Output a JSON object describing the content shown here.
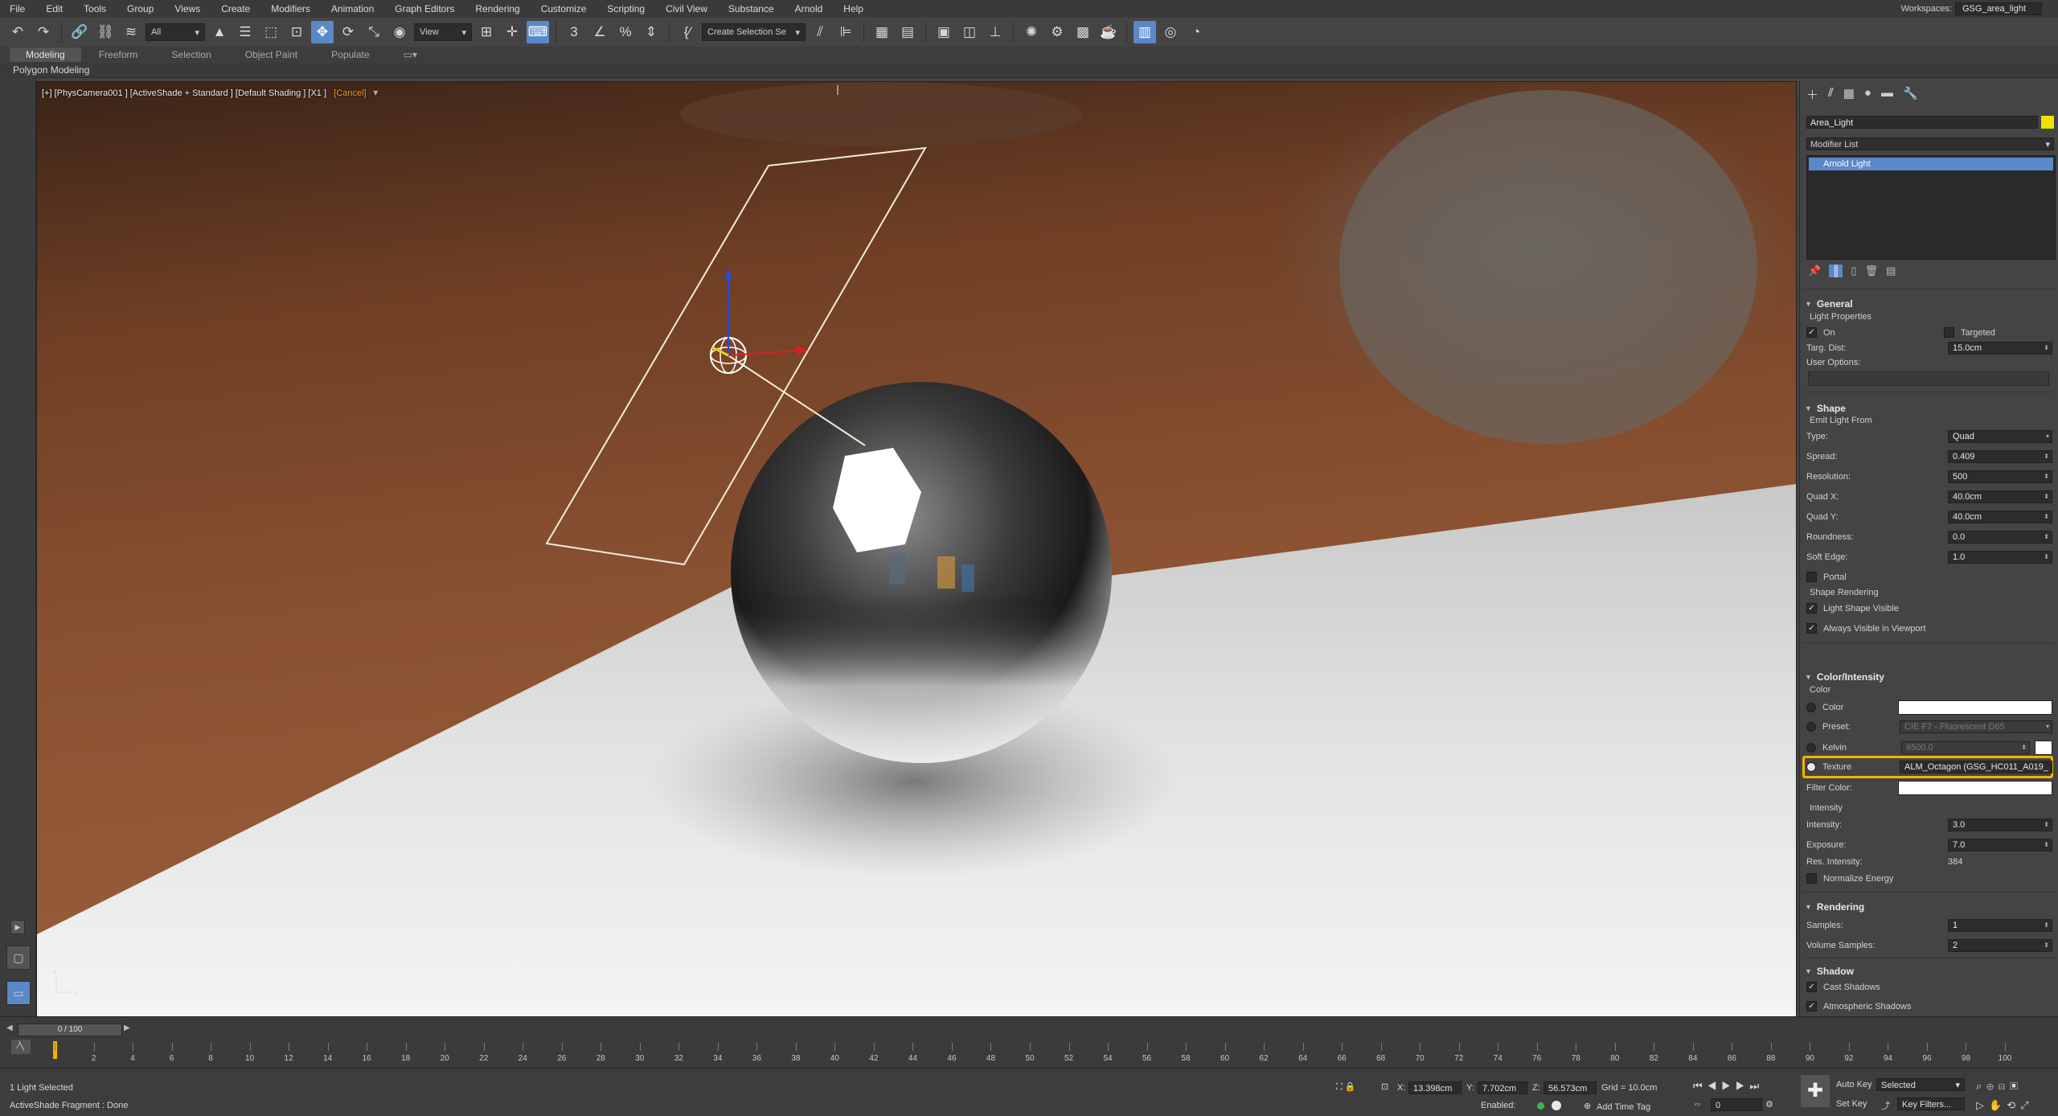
{
  "menu": [
    "File",
    "Edit",
    "Tools",
    "Group",
    "Views",
    "Create",
    "Modifiers",
    "Animation",
    "Graph Editors",
    "Rendering",
    "Customize",
    "Scripting",
    "Civil View",
    "Substance",
    "Arnold",
    "Help"
  ],
  "workspace": {
    "label": "Workspaces:",
    "value": "GSG_area_light"
  },
  "toolbar": {
    "filter_value": "All",
    "ref_coord_value": "View",
    "selection_set_value": "Create Selection Se"
  },
  "ribbon": {
    "tabs": [
      "Modeling",
      "Freeform",
      "Selection",
      "Object Paint",
      "Populate"
    ],
    "active_tab": "Modeling",
    "sub_label": "Polygon Modeling"
  },
  "viewport": {
    "label_main": "[+] [PhysCamera001 ] [ActiveShade + Standard ] [Default Shading ] [X1 ]",
    "label_cancel": "[Cancel]"
  },
  "command_panel": {
    "object_name": "Area_Light",
    "object_color": "#f0e000",
    "modifier_list": "Modifier List",
    "modifier_stack": [
      "Arnold Light"
    ],
    "general": {
      "title": "General",
      "light_properties": "Light Properties",
      "on_label": "On",
      "targeted_label": "Targeted",
      "targ_dist_label": "Targ. Dist:",
      "targ_dist_value": "15.0cm",
      "user_options_label": "User Options:"
    },
    "shape": {
      "title": "Shape",
      "emit_from": "Emit Light From",
      "fields": [
        {
          "label": "Type:",
          "value": "Quad"
        },
        {
          "label": "Spread:",
          "value": "0.409"
        },
        {
          "label": "Resolution:",
          "value": "500"
        },
        {
          "label": "Quad X:",
          "value": "40.0cm"
        },
        {
          "label": "Quad Y:",
          "value": "40.0cm"
        },
        {
          "label": "Roundness:",
          "value": "0.0"
        },
        {
          "label": "Soft Edge:",
          "value": "1.0"
        }
      ],
      "portal_label": "Portal",
      "shape_rendering": "Shape Rendering",
      "light_shape_visible": "Light Shape Visible",
      "always_visible": "Always Visible in Viewport"
    },
    "color_intensity": {
      "title": "Color/Intensity",
      "color_group": "Color",
      "color_label": "Color",
      "preset_label": "Preset:",
      "preset_value": "CIE F7 - Fluorescent D65",
      "kelvin_label": "Kelvin",
      "kelvin_value": "6500.0",
      "texture_label": "Texture",
      "texture_value": "ALM_Octagon (GSG_HC011_A019_",
      "filter_color_label": "Filter Color:",
      "intensity_group": "Intensity",
      "intensity_label": "Intensity:",
      "intensity_value": "3.0",
      "exposure_label": "Exposure:",
      "exposure_value": "7.0",
      "res_intensity_label": "Res. Intensity:",
      "res_intensity_value": "384",
      "normalize_label": "Normalize Energy",
      "highlight_color": "#f0b400"
    },
    "rendering": {
      "title": "Rendering",
      "samples_label": "Samples:",
      "samples_value": "1",
      "volume_samples_label": "Volume Samples:",
      "volume_samples_value": "2"
    },
    "shadow": {
      "title": "Shadow",
      "cast_label": "Cast Shadows",
      "atmospheric_label": "Atmospheric Shadows"
    }
  },
  "timeline": {
    "frame_display": "0 / 100",
    "ticks": [
      "0",
      "2",
      "4",
      "6",
      "8",
      "10",
      "12",
      "14",
      "16",
      "18",
      "20",
      "22",
      "24",
      "26",
      "28",
      "30",
      "32",
      "34",
      "36",
      "38",
      "40",
      "42",
      "44",
      "46",
      "48",
      "50",
      "52",
      "54",
      "56",
      "58",
      "60",
      "62",
      "64",
      "66",
      "68",
      "70",
      "72",
      "74",
      "76",
      "78",
      "80",
      "82",
      "84",
      "86",
      "88",
      "90",
      "92",
      "94",
      "96",
      "98",
      "100"
    ]
  },
  "status": {
    "selection": "1 Light Selected",
    "message": "ActiveShade Fragment : Done",
    "x_label": "X:",
    "x_value": "13.398cm",
    "y_label": "Y:",
    "y_value": "7.702cm",
    "z_label": "Z:",
    "z_value": "56.573cm",
    "grid": "Grid = 10.0cm",
    "enabled_label": "Enabled:",
    "add_time_tag": "Add Time Tag",
    "auto_key": "Auto Key",
    "set_key": "Set Key",
    "selected_value": "Selected",
    "key_filters": "Key Filters...",
    "frame_value": "0"
  }
}
